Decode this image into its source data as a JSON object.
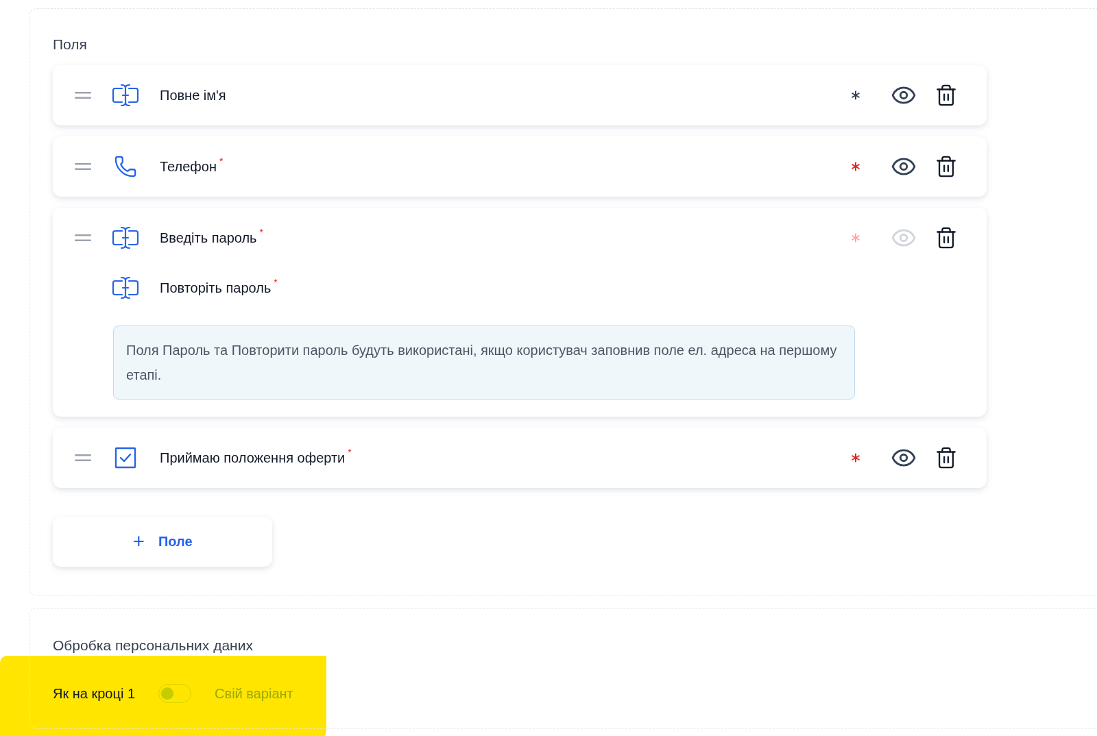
{
  "fields_section": {
    "title": "Поля",
    "fields": [
      {
        "kind": "text",
        "label": "Повне ім'я",
        "required": false,
        "visible": true,
        "locked": false
      },
      {
        "kind": "phone",
        "label": "Телефон",
        "mark": "*",
        "required": true,
        "visible": true,
        "locked": false
      },
      {
        "kind": "text",
        "label": "Введіть пароль",
        "mark": "*",
        "required": true,
        "visible": true,
        "locked": true,
        "sub": {
          "kind": "text",
          "label": "Повторіть пароль",
          "mark": "*"
        },
        "note": "Поля Пароль та Повторити пароль будуть використані, якщо користувач заповнив поле ел. адреса на першому етапі."
      },
      {
        "kind": "checkbox",
        "label": "Приймаю положення оферти",
        "mark": "*",
        "required": true,
        "visible": true,
        "locked": false
      }
    ],
    "add_button": {
      "icon": "+",
      "label": "Поле"
    }
  },
  "personal_data": {
    "title": "Обробка персональних даних",
    "left_label": "Як на кроці 1",
    "toggle": {
      "on": false
    },
    "right_label": "Свій варіант",
    "highlighted": true
  }
}
